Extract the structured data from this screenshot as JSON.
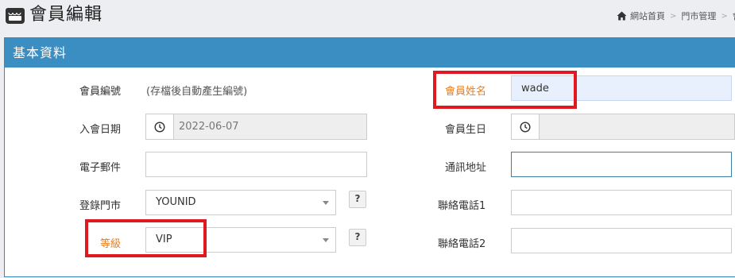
{
  "header": {
    "title": "會員編輯",
    "breadcrumb": {
      "home": "網站首頁",
      "section": "門市管理",
      "current": "會"
    }
  },
  "panel": {
    "title": "基本資料"
  },
  "form": {
    "member_no": {
      "label": "會員編號",
      "value": "(存檔後自動產生編號)"
    },
    "join_date": {
      "label": "入會日期",
      "value": "2022-06-07"
    },
    "email": {
      "label": "電子郵件",
      "value": ""
    },
    "store": {
      "label": "登錄門市",
      "value": "YOUNID",
      "help": "?"
    },
    "level": {
      "label": "等級",
      "value": "VIP",
      "help": "?"
    },
    "name": {
      "label": "會員姓名",
      "value": "wade"
    },
    "birthday": {
      "label": "會員生日",
      "value": ""
    },
    "address": {
      "label": "通訊地址",
      "value": ""
    },
    "phone1": {
      "label": "聯絡電話1",
      "value": ""
    },
    "phone2": {
      "label": "聯絡電話2",
      "value": ""
    }
  },
  "colors": {
    "panel_header": "#3b8ec2",
    "highlight": "#e0181f",
    "label_accent": "#e67e22",
    "filled_input": "#e8f0fe"
  },
  "icons": [
    "store-icon",
    "home-icon",
    "clock-icon",
    "chevron-down-icon"
  ]
}
